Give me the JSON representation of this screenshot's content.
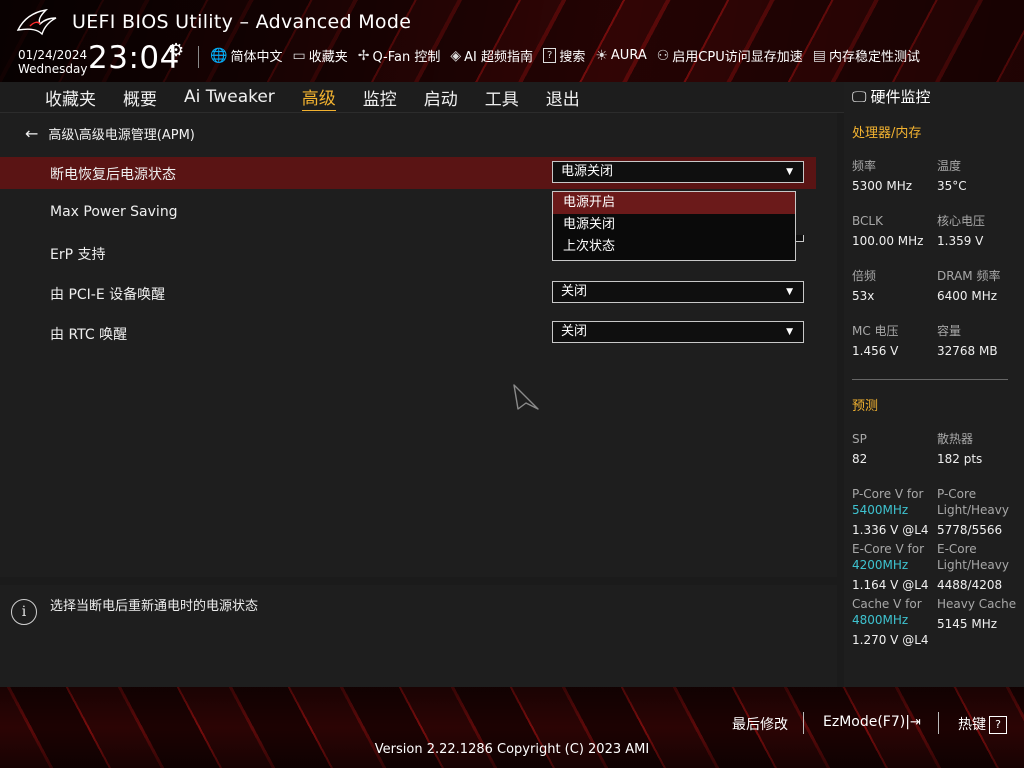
{
  "header": {
    "title": "UEFI BIOS Utility – Advanced Mode",
    "date": "01/24/2024",
    "weekday": "Wednesday",
    "time": "23:04",
    "tools": [
      {
        "icon": "globe-icon",
        "label": "简体中文"
      },
      {
        "icon": "folder-icon",
        "label": "收藏夹"
      },
      {
        "icon": "fan-icon",
        "label": "Q-Fan 控制"
      },
      {
        "icon": "ai-chip-icon",
        "label": "AI 超频指南"
      },
      {
        "icon": "search-box-icon",
        "label": "搜索"
      },
      {
        "icon": "aura-light-icon",
        "label": "AURA"
      },
      {
        "icon": "cpu-memory-icon",
        "label": "启用CPU访问显存加速"
      },
      {
        "icon": "memory-test-icon",
        "label": "内存稳定性测试"
      }
    ]
  },
  "menu": {
    "tabs": [
      "收藏夹",
      "概要",
      "Ai Tweaker",
      "高级",
      "监控",
      "启动",
      "工具",
      "退出"
    ],
    "active_index": 3
  },
  "main": {
    "breadcrumb": "高级\\高级电源管理(APM)",
    "settings": [
      {
        "label": "断电恢复后电源状态",
        "value": "电源关闭"
      },
      {
        "label": "Max Power Saving",
        "value": ""
      },
      {
        "label": "ErP 支持",
        "value": ""
      },
      {
        "label": "由 PCI-E 设备唤醒",
        "value": "关闭"
      },
      {
        "label": "由 RTC 唤醒",
        "value": "关闭"
      }
    ],
    "dropdown_options": [
      "电源开启",
      "电源关闭",
      "上次状态"
    ],
    "dropdown_highlight_index": 0
  },
  "help": {
    "text": "选择当断电后重新通电时的电源状态"
  },
  "hardware_monitor": {
    "title": "硬件监控",
    "cpu_section": "处理器/内存",
    "cpu": [
      {
        "k": "频率",
        "v": "5300 MHz"
      },
      {
        "k": "温度",
        "v": "35°C"
      },
      {
        "k": "BCLK",
        "v": "100.00 MHz"
      },
      {
        "k": "核心电压",
        "v": "1.359 V"
      },
      {
        "k": "倍频",
        "v": "53x"
      },
      {
        "k": "DRAM 频率",
        "v": "6400 MHz"
      },
      {
        "k": "MC 电压",
        "v": "1.456 V"
      },
      {
        "k": "容量",
        "v": "32768 MB"
      }
    ],
    "prediction_section": "预测",
    "sp_label": "SP",
    "sp_value": "82",
    "cooler_label": "散热器",
    "cooler_value": "182 pts",
    "pcore_v_label": "P-Core V for",
    "pcore_v_freq": "5400MHz",
    "pcore_v_value": "1.336 V @L4",
    "pcore_lh_label1": "P-Core",
    "pcore_lh_label2": "Light/Heavy",
    "pcore_lh_value": "5778/5566",
    "ecore_v_label": "E-Core V for",
    "ecore_v_freq": "4200MHz",
    "ecore_v_value": "1.164 V @L4",
    "ecore_lh_label1": "E-Core",
    "ecore_lh_label2": "Light/Heavy",
    "ecore_lh_value": "4488/4208",
    "cache_v_label": "Cache V for",
    "cache_v_freq": "4800MHz",
    "cache_v_value": "1.270 V @L4",
    "heavy_cache_label": "Heavy Cache",
    "heavy_cache_value": "5145 MHz"
  },
  "footer": {
    "last_modified": "最后修改",
    "ezmode": "EzMode(F7)|",
    "hotkeys": "热键",
    "hotkey_symbol": "?",
    "version": "Version 2.22.1286 Copyright (C) 2023 AMI"
  },
  "colors": {
    "accent_gold": "#f2b230",
    "selected_row": "#5a1414",
    "highlight_option": "#6b1a1a",
    "cyan_value": "#3ec3d0"
  }
}
